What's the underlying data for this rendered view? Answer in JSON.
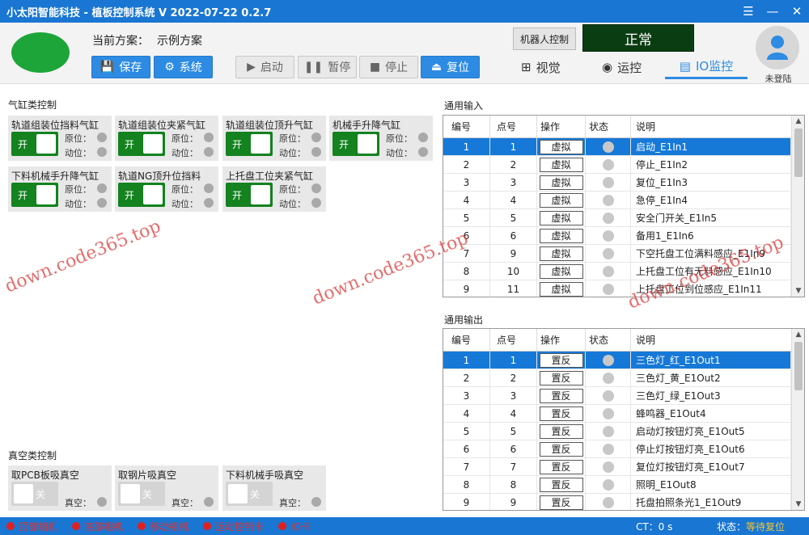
{
  "window": {
    "title": "小太阳智能科技 - 植板控制系统  V 2022-07-22 0.2.7",
    "icons": [
      "menu-icon",
      "minimize-icon",
      "close-icon"
    ]
  },
  "header": {
    "scheme_label": "当前方案：",
    "scheme_value": "示例方案",
    "save_label": "保存",
    "system_label": "系统",
    "start_label": "启动",
    "pause_label": "暂停",
    "stop_label": "停止",
    "reset_label": "复位",
    "robot_label": "机器人控制",
    "status_text": "正常",
    "tabs": [
      {
        "label": "视觉",
        "icon": "windows-icon"
      },
      {
        "label": "运控",
        "icon": "camera-icon"
      },
      {
        "label": "IO监控",
        "icon": "list-icon"
      }
    ],
    "login_label": "未登陆",
    "colors": {
      "accent": "#2d8be3",
      "status_bg": "#0b3d12",
      "logo": "#1ea53a"
    }
  },
  "cylinder_section": {
    "title": "气缸类控制",
    "origin_label": "原位：",
    "active_label": "动位：",
    "on_label": "开",
    "items": [
      {
        "name": "轨道组装位挡料气缸"
      },
      {
        "name": "轨道组装位夹紧气缸"
      },
      {
        "name": "轨道组装位顶升气缸"
      },
      {
        "name": "机械手升降气缸"
      },
      {
        "name": "下料机械手升降气缸"
      },
      {
        "name": "轨道NG顶升位挡料"
      },
      {
        "name": "上托盘工位夹紧气缸"
      }
    ]
  },
  "vacuum_section": {
    "title": "真空类控制",
    "vac_label": "真空：",
    "off_label": "关",
    "items": [
      {
        "name": "取PCB板吸真空"
      },
      {
        "name": "取钢片吸真空"
      },
      {
        "name": "下料机械手吸真空"
      }
    ]
  },
  "input_table": {
    "title": "通用输入",
    "headers": [
      "编号",
      "点号",
      "操作",
      "状态",
      "说明"
    ],
    "rows": [
      {
        "no": "1",
        "point": "1",
        "op": "虚拟",
        "desc": "启动_E1In1"
      },
      {
        "no": "2",
        "point": "2",
        "op": "虚拟",
        "desc": "停止_E1In2"
      },
      {
        "no": "3",
        "point": "3",
        "op": "虚拟",
        "desc": "复位_E1In3"
      },
      {
        "no": "4",
        "point": "4",
        "op": "虚拟",
        "desc": "急停_E1In4"
      },
      {
        "no": "5",
        "point": "5",
        "op": "虚拟",
        "desc": "安全门开关_E1In5"
      },
      {
        "no": "6",
        "point": "6",
        "op": "虚拟",
        "desc": "备用1_E1In6"
      },
      {
        "no": "7",
        "point": "9",
        "op": "虚拟",
        "desc": "下空托盘工位满料感应_E1In9"
      },
      {
        "no": "8",
        "point": "10",
        "op": "虚拟",
        "desc": "上托盘工位有无料感应_E1In10"
      },
      {
        "no": "9",
        "point": "11",
        "op": "虚拟",
        "desc": "上托盘工位到位感应_E1In11"
      }
    ]
  },
  "output_table": {
    "title": "通用输出",
    "headers": [
      "编号",
      "点号",
      "操作",
      "状态",
      "说明"
    ],
    "rows": [
      {
        "no": "1",
        "point": "1",
        "op": "置反",
        "desc": "三色灯_红_E1Out1"
      },
      {
        "no": "2",
        "point": "2",
        "op": "置反",
        "desc": "三色灯_黄_E1Out2"
      },
      {
        "no": "3",
        "point": "3",
        "op": "置反",
        "desc": "三色灯_绿_E1Out3"
      },
      {
        "no": "4",
        "point": "4",
        "op": "置反",
        "desc": "蜂鸣器_E1Out4"
      },
      {
        "no": "5",
        "point": "5",
        "op": "置反",
        "desc": "启动灯按钮灯亮_E1Out5"
      },
      {
        "no": "6",
        "point": "6",
        "op": "置反",
        "desc": "停止灯按钮灯亮_E1Out6"
      },
      {
        "no": "7",
        "point": "7",
        "op": "置反",
        "desc": "复位灯按钮灯亮_E1Out7"
      },
      {
        "no": "8",
        "point": "8",
        "op": "置反",
        "desc": "照明_E1Out8"
      },
      {
        "no": "9",
        "point": "9",
        "op": "置反",
        "desc": "托盘拍照条光1_E1Out9"
      }
    ]
  },
  "footer": {
    "devices": [
      "顶部相机",
      "底部相机",
      "移动相机",
      "运动控制卡",
      "IO卡"
    ],
    "ct_label": "CT：0 s",
    "status_label": "状态：",
    "status_value": "等待复位"
  },
  "watermarks": [
    "down.code365.top",
    "down.code365.top",
    "down.code365.top"
  ]
}
